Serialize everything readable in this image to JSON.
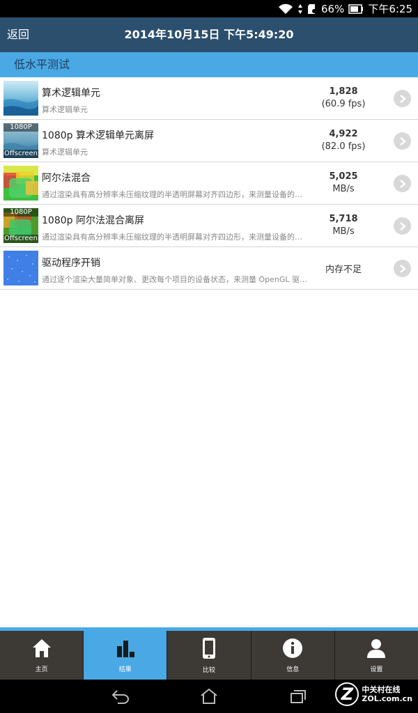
{
  "status_bar": {
    "battery": "66%",
    "time": "下午6:25"
  },
  "header": {
    "back_label": "返回",
    "title": "2014年10月15日 下午5:49:20"
  },
  "section_title": "低水平测试",
  "tests": [
    {
      "title": "算术逻辑单元",
      "desc": "算术逻辑单元",
      "value": "1,828",
      "unit": "(60.9 fps)",
      "thumb": "arithmetic"
    },
    {
      "title": "1080p 算术逻辑单元离屏",
      "desc": "算术逻辑单元",
      "value": "4,922",
      "unit": "(82.0 fps)",
      "thumb": "arithmetic-offscreen",
      "thumb_top": "1080P",
      "thumb_bottom": "Offscreen"
    },
    {
      "title": "阿尔法混合",
      "desc": "通过渲染具有高分辨率未压缩纹理的半透明屏幕对齐四边形，来测量设备的…",
      "value": "5,025",
      "unit": "MB/s",
      "thumb": "alpha-blend"
    },
    {
      "title": "1080p 阿尔法混合离屏",
      "desc": "通过渲染具有高分辨率未压缩纹理的半透明屏幕对齐四边形，来测量设备的…",
      "value": "5,718",
      "unit": "MB/s",
      "thumb": "alpha-blend-offscreen",
      "thumb_top": "1080P",
      "thumb_bottom": "Offscreen"
    },
    {
      "title": "驱动程序开销",
      "desc": "通过逐个渲染大量简单对象、更改每个项目的设备状态，来测量 OpenGL 驱…",
      "value": "内存不足",
      "thumb": "driver-overhead"
    }
  ],
  "tabs": [
    {
      "label": "主页",
      "icon": "home-icon"
    },
    {
      "label": "结果",
      "icon": "bar-chart-icon",
      "active": true
    },
    {
      "label": "比较",
      "icon": "phone-icon"
    },
    {
      "label": "信息",
      "icon": "info-icon"
    },
    {
      "label": "设置",
      "icon": "user-icon"
    }
  ],
  "watermark": {
    "logo_letter": "Z",
    "line1": "中关村在线",
    "line2": "ZOL.com.cn"
  },
  "colors": {
    "header": "#2c4f6e",
    "accent": "#4aa9e4",
    "tabbar": "#3d3a36"
  }
}
